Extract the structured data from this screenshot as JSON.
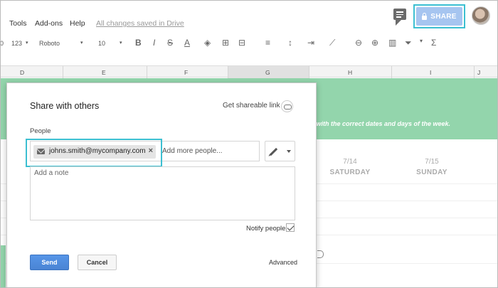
{
  "menu": {
    "items": [
      "Tools",
      "Add-ons",
      "Help"
    ],
    "saved_status": "All changes saved in Drive"
  },
  "header": {
    "share_label": "SHARE",
    "accent_color": "#3cbfd1",
    "share_color": "#a6c5f0"
  },
  "toolbar": {
    "left_fragment": "0",
    "number_format": "123",
    "font": "Roboto",
    "font_size": "10",
    "bold": "B",
    "italic": "I",
    "strike": "S",
    "text_color": "A",
    "sum": "Σ"
  },
  "sheet": {
    "columns": [
      "D",
      "E",
      "F",
      "G",
      "H",
      "I",
      "J"
    ],
    "band_text": "odate with the correct dates and days of the week.",
    "band_color": "#93d5ac",
    "days": [
      {
        "date": "7/14",
        "name": "SATURDAY"
      },
      {
        "date": "7/15",
        "name": "SUNDAY"
      }
    ]
  },
  "dialog": {
    "title": "Share with others",
    "get_link": "Get shareable link",
    "people_label": "People",
    "chip_email": "johns.smith@mycompany.com",
    "chip_remove": "×",
    "add_people_placeholder": "Add more people...",
    "note_placeholder": "Add a note",
    "notify_label": "Notify people",
    "notify_checked": true,
    "send_label": "Send",
    "cancel_label": "Cancel",
    "advanced_label": "Advanced"
  }
}
